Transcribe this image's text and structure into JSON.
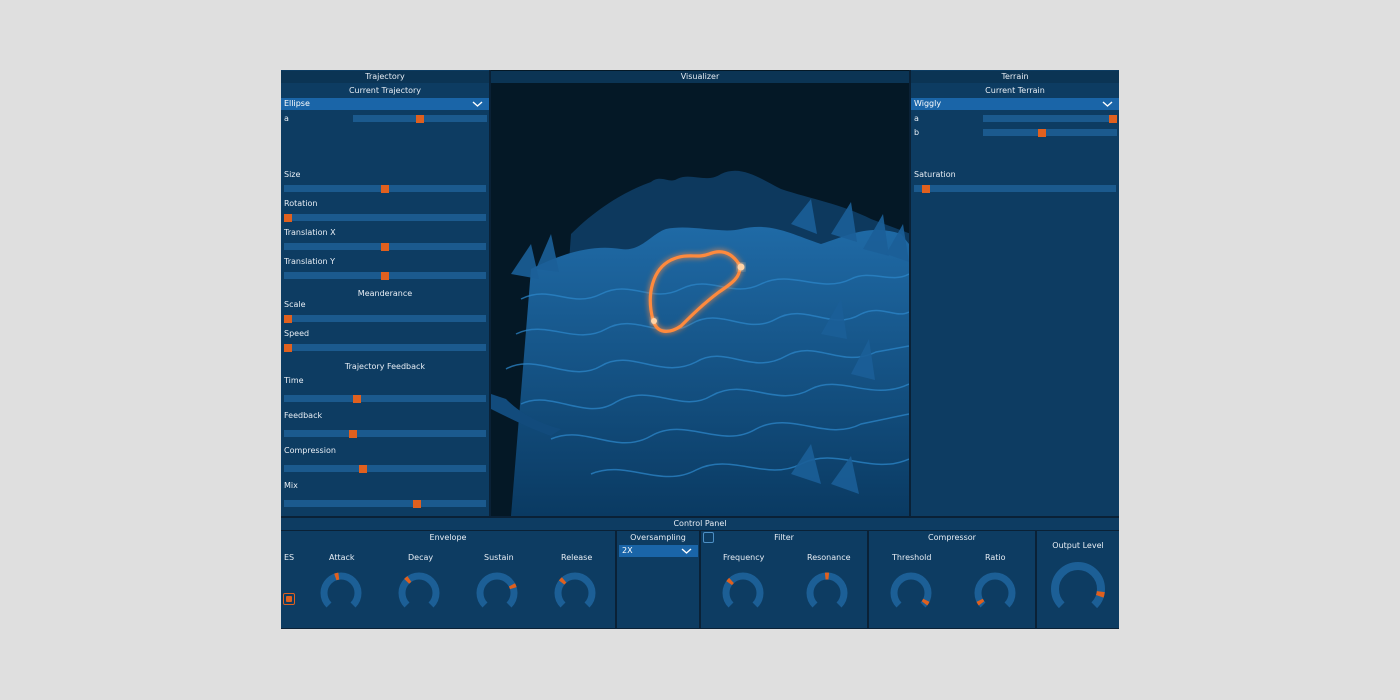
{
  "trajectory": {
    "title": "Trajectory",
    "current_label": "Current Trajectory",
    "dropdown_value": "Ellipse",
    "param_a_label": "a",
    "param_a_value": 0.5,
    "size_label": "Size",
    "size_value": 0.5,
    "rotation_label": "Rotation",
    "rotation_value": 0.02,
    "translation_x_label": "Translation X",
    "translation_x_value": 0.5,
    "translation_y_label": "Translation Y",
    "translation_y_value": 0.5,
    "meanderance_title": "Meanderance",
    "scale_label": "Scale",
    "scale_value": 0.02,
    "speed_label": "Speed",
    "speed_value": 0.02,
    "feedback_title": "Trajectory Feedback",
    "time_label": "Time",
    "time_value": 0.36,
    "feedback_label": "Feedback",
    "feedback_value": 0.34,
    "compression_label": "Compression",
    "compression_value": 0.39,
    "mix_label": "Mix",
    "mix_value": 0.66
  },
  "visualizer": {
    "title": "Visualizer",
    "terrain_color": "#1a6fb0",
    "trajectory_color": "#ff8a3c"
  },
  "terrain": {
    "title": "Terrain",
    "current_label": "Current Terrain",
    "dropdown_value": "Wiggly",
    "param_a_label": "a",
    "param_a_value": 0.99,
    "param_b_label": "b",
    "param_b_value": 0.44,
    "saturation_label": "Saturation",
    "saturation_value": 0.06
  },
  "control_panel": {
    "title": "Control Panel",
    "envelope": {
      "title": "Envelope",
      "es_label": "ES",
      "attack_label": "Attack",
      "attack_value": 0.45,
      "decay_label": "Decay",
      "decay_value": 0.35,
      "sustain_label": "Sustain",
      "sustain_value": 0.75,
      "release_label": "Release",
      "release_value": 0.33
    },
    "oversampling": {
      "title": "Oversampling",
      "value": "2X"
    },
    "filter": {
      "title": "Filter",
      "frequency_label": "Frequency",
      "frequency_value": 0.32,
      "resonance_label": "Resonance",
      "resonance_value": 0.5
    },
    "compressor": {
      "title": "Compressor",
      "threshold_label": "Threshold",
      "threshold_value": 0.95,
      "ratio_label": "Ratio",
      "ratio_value": 0.05
    },
    "output": {
      "title": "Output Level",
      "value": 0.88
    }
  },
  "colors": {
    "accent": "#e0601e",
    "panel": "#0d3c62",
    "track": "#1b5a8e",
    "knob_track": "#1c5f96"
  }
}
